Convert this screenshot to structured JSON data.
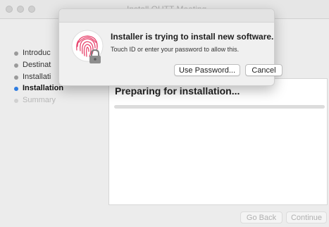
{
  "window": {
    "title": "Install OUTT Meeting"
  },
  "sidebar": {
    "steps": [
      {
        "label": "Introduc",
        "state": "done"
      },
      {
        "label": "Destinat",
        "state": "done"
      },
      {
        "label": "Installati",
        "state": "done"
      },
      {
        "label": "Installation",
        "state": "active"
      },
      {
        "label": "Summary",
        "state": "pending"
      }
    ]
  },
  "main": {
    "heading": "Preparing for installation...",
    "progress_fraction": 0.0
  },
  "footer": {
    "go_back_label": "Go Back",
    "continue_label": "Continue"
  },
  "dialog": {
    "title": "Installer is trying to install new software.",
    "message": "Touch ID or enter your password to allow this.",
    "use_password_label": "Use Password...",
    "cancel_label": "Cancel",
    "icons": [
      "fingerprint-icon",
      "lock-icon"
    ]
  },
  "colors": {
    "accent": "#2f7de0",
    "fingerprint": "#e8456e"
  }
}
